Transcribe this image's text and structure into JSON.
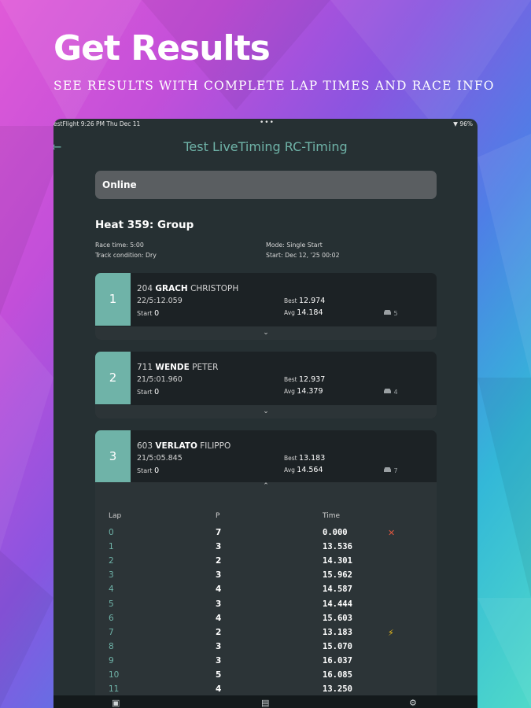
{
  "headline": "Get Results",
  "subline": "SEE RESULTS WITH COMPLETE LAP TIMES AND RACE INFO",
  "status": {
    "left": "estFlight   9:26 PM   Thu Dec 11",
    "dots": "•••",
    "right": "▼ 96%"
  },
  "app_title": "Test LiveTiming RC-Timing",
  "connection": "Online",
  "heat": {
    "title": "Heat 359: Group",
    "race_time": "Race time: 5:00",
    "track": "Track condition: Dry",
    "mode": "Mode: Single Start",
    "start": "Start: Dec 12, '25 00:02"
  },
  "drivers": [
    {
      "pos": "1",
      "num": "204",
      "last": "GRACH",
      "first": "CHRISTOPH",
      "laps": "22/5:12.059",
      "start_label": "Start",
      "start": "0",
      "best_label": "Best",
      "best": "12.974",
      "avg_label": "Avg",
      "avg": "14.184",
      "car": "5"
    },
    {
      "pos": "2",
      "num": "711",
      "last": "WENDE",
      "first": "PETER",
      "laps": "21/5:01.960",
      "start_label": "Start",
      "start": "0",
      "best_label": "Best",
      "best": "12.937",
      "avg_label": "Avg",
      "avg": "14.379",
      "car": "4"
    },
    {
      "pos": "3",
      "num": "603",
      "last": "VERLATO",
      "first": "FILIPPO",
      "laps": "21/5:05.845",
      "start_label": "Start",
      "start": "0",
      "best_label": "Best",
      "best": "13.183",
      "avg_label": "Avg",
      "avg": "14.564",
      "car": "7"
    }
  ],
  "lap_table": {
    "headers": [
      "Lap",
      "P",
      "Time"
    ],
    "rows": [
      {
        "lap": "0",
        "p": "7",
        "time": "0.000",
        "flag": "✕"
      },
      {
        "lap": "1",
        "p": "3",
        "time": "13.536",
        "flag": ""
      },
      {
        "lap": "2",
        "p": "2",
        "time": "14.301",
        "flag": ""
      },
      {
        "lap": "3",
        "p": "3",
        "time": "15.962",
        "flag": ""
      },
      {
        "lap": "4",
        "p": "4",
        "time": "14.587",
        "flag": ""
      },
      {
        "lap": "5",
        "p": "3",
        "time": "14.444",
        "flag": ""
      },
      {
        "lap": "6",
        "p": "4",
        "time": "15.603",
        "flag": ""
      },
      {
        "lap": "7",
        "p": "2",
        "time": "13.183",
        "flag": "⚡"
      },
      {
        "lap": "8",
        "p": "3",
        "time": "15.070",
        "flag": ""
      },
      {
        "lap": "9",
        "p": "3",
        "time": "16.037",
        "flag": ""
      },
      {
        "lap": "10",
        "p": "5",
        "time": "16.085",
        "flag": ""
      },
      {
        "lap": "11",
        "p": "4",
        "time": "13.250",
        "flag": ""
      }
    ]
  },
  "icons": {
    "car": "car-icon",
    "expand": "⌄",
    "collapse": "⌃"
  },
  "colors": {
    "accent": "#6fb3a8",
    "card": "#1c2225",
    "panel": "#263033",
    "fastest": "#f2c21b",
    "error": "#e0573f"
  }
}
